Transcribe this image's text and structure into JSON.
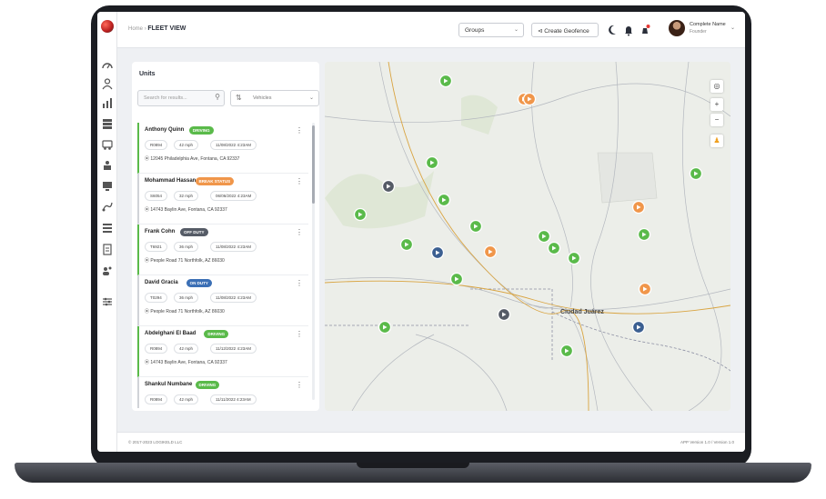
{
  "header": {
    "breadcrumb_home": "Home",
    "breadcrumb_sep": "›",
    "page_title": "FLEET VIEW",
    "groups_select": "Groups",
    "create_geofence": "Create Geofence",
    "user_name": "Complete Name",
    "user_role": "Founder"
  },
  "units": {
    "title": "Units",
    "search_placeholder": "Search for results...",
    "filter_value": "Vehicles",
    "items": [
      {
        "name": "Anthony Quinn",
        "status": "DRIVING",
        "status_color": "#5aba4a",
        "id": "R0894",
        "speed": "42 mph",
        "time": "11/08/2022 4:23AM",
        "address": "12045 Philadelphia Ave, Fontana, CA 92337"
      },
      {
        "name": "Mohammad Hassan",
        "status": "BREAK STATUS",
        "status_color": "#f0964a",
        "id": "S6054",
        "speed": "32 mph",
        "time": "06/06/2022 4:23AM",
        "address": "14743 Baylin Ave, Fontana, CA 92337"
      },
      {
        "name": "Frank Cohn",
        "status": "OFF DUTY",
        "status_color": "#555b66",
        "id": "T6921",
        "speed": "36 mph",
        "time": "11/08/2022 4:23AM",
        "address": "People Road 71 Northfolk, AZ 86030"
      },
      {
        "name": "David Gracia",
        "status": "ON DUTY",
        "status_color": "#3b6fb5",
        "id": "T0294",
        "speed": "36 mph",
        "time": "11/08/2022 4:23AM",
        "address": "People Road 71 Northfolk, AZ 86030"
      },
      {
        "name": "Abdelghani El Baad",
        "status": "DRIVING",
        "status_color": "#5aba4a",
        "id": "R0894",
        "speed": "42 mph",
        "time": "11/12/2022 4:23AM",
        "address": "14743 Baylin Ave, Fontana, CA 92337"
      },
      {
        "name": "Shankul Numbane",
        "status": "DRIVING",
        "status_color": "#5aba4a",
        "id": "R0894",
        "speed": "42 mph",
        "time": "11/11/2022 4:23AM",
        "address": ""
      }
    ]
  },
  "map": {
    "city_label": "Ciudad Juárez",
    "zoom_in": "+",
    "zoom_out": "−"
  },
  "footer": {
    "copyright": "© 2017-2023 LOGIKELD LLC",
    "version": "APP Version 1.0 / Version 1.0"
  },
  "icons": [
    "logo-icon",
    "dashboard-icon",
    "users-icon",
    "chart-icon",
    "list-icon",
    "truck-icon",
    "trailer-icon",
    "monitor-icon",
    "fuel-icon",
    "report-icon",
    "clipboard-icon",
    "people-icon",
    "settings-icon",
    "moon-icon",
    "bell-icon",
    "notification-icon",
    "search-icon",
    "sort-icon",
    "map-pin-icon",
    "kebab-icon",
    "layers-icon",
    "person-icon"
  ]
}
